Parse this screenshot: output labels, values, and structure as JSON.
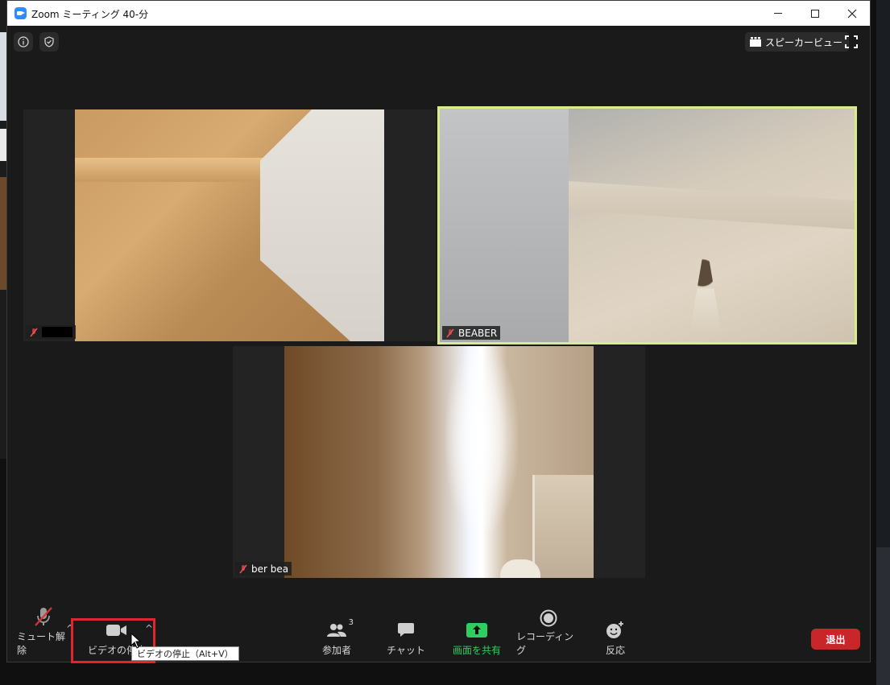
{
  "window": {
    "title": "Zoom ミーティング 40-分"
  },
  "top_bar": {
    "speaker_view_label": "スピーカービュー"
  },
  "participants": [
    {
      "name": "",
      "name_redacted": true,
      "muted": true,
      "active_speaker": false
    },
    {
      "name": "BEABER",
      "name_redacted": false,
      "muted": true,
      "active_speaker": true
    },
    {
      "name": "ber bea",
      "name_redacted": false,
      "muted": true,
      "active_speaker": false
    }
  ],
  "toolbar": {
    "unmute_label": "ミュート解除",
    "video_label": "ビデオの停止",
    "participants_label": "参加者",
    "participants_count": "3",
    "chat_label": "チャット",
    "share_label": "画面を共有",
    "record_label": "レコーディング",
    "react_label": "反応",
    "leave_label": "退出"
  },
  "tooltip": {
    "text": "ビデオの停止（Alt+V）"
  },
  "colors": {
    "active_speaker_border": "#d7ec8c",
    "share_green": "#2fcf5f",
    "leave_red": "#c8262a",
    "highlight_red": "#e1242d"
  }
}
